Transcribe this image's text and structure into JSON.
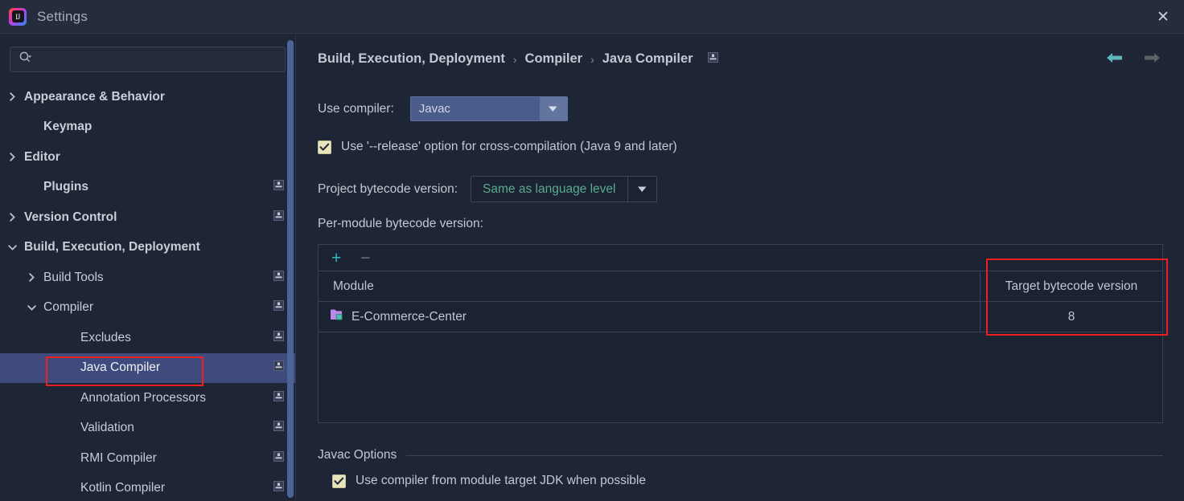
{
  "window": {
    "title": "Settings",
    "logo_text": "IJ",
    "logo_icon": "intellij-idea-logo",
    "close_icon": "close-icon"
  },
  "search": {
    "value": "",
    "placeholder": "",
    "icon": "search-icon"
  },
  "sidebar": {
    "items": [
      {
        "label": "Appearance & Behavior",
        "twisty": "chevron-right-icon",
        "indent": 22,
        "bold": true,
        "badge": false,
        "selected": false
      },
      {
        "label": "Keymap",
        "twisty": "none",
        "indent": 46,
        "bold": true,
        "badge": false,
        "selected": false
      },
      {
        "label": "Editor",
        "twisty": "chevron-right-icon",
        "indent": 22,
        "bold": true,
        "badge": false,
        "selected": false
      },
      {
        "label": "Plugins",
        "twisty": "none",
        "indent": 46,
        "bold": true,
        "badge": true,
        "selected": false
      },
      {
        "label": "Version Control",
        "twisty": "chevron-right-icon",
        "indent": 22,
        "bold": true,
        "badge": true,
        "selected": false
      },
      {
        "label": "Build, Execution, Deployment",
        "twisty": "chevron-down-icon",
        "indent": 22,
        "bold": true,
        "badge": false,
        "selected": false
      },
      {
        "label": "Build Tools",
        "twisty": "chevron-right-icon",
        "indent": 46,
        "bold": false,
        "badge": true,
        "selected": false
      },
      {
        "label": "Compiler",
        "twisty": "chevron-down-icon",
        "indent": 46,
        "bold": false,
        "badge": true,
        "selected": false
      },
      {
        "label": "Excludes",
        "twisty": "none",
        "indent": 92,
        "bold": false,
        "badge": true,
        "selected": false
      },
      {
        "label": "Java Compiler",
        "twisty": "none",
        "indent": 92,
        "bold": false,
        "badge": true,
        "selected": true
      },
      {
        "label": "Annotation Processors",
        "twisty": "none",
        "indent": 92,
        "bold": false,
        "badge": true,
        "selected": false
      },
      {
        "label": "Validation",
        "twisty": "none",
        "indent": 92,
        "bold": false,
        "badge": true,
        "selected": false
      },
      {
        "label": "RMI Compiler",
        "twisty": "none",
        "indent": 92,
        "bold": false,
        "badge": true,
        "selected": false
      },
      {
        "label": "Kotlin Compiler",
        "twisty": "none",
        "indent": 92,
        "bold": false,
        "badge": true,
        "selected": false
      }
    ],
    "scrollbar": "vertical-scrollbar"
  },
  "breadcrumb": {
    "crumbs": [
      "Build, Execution, Deployment",
      "Compiler",
      "Java Compiler"
    ],
    "separator": "›",
    "badge_icon": "project-scope-badge-icon"
  },
  "nav": {
    "back_icon": "arrow-left-icon",
    "forward_icon": "arrow-right-icon"
  },
  "main": {
    "use_compiler_label": "Use compiler:",
    "use_compiler_value": "Javac",
    "release_option_label": "Use '--release' option for cross-compilation (Java 9 and later)",
    "release_option_checked": true,
    "project_bytecode_label": "Project bytecode version:",
    "project_bytecode_value": "Same as language level",
    "per_module_label": "Per-module bytecode version:"
  },
  "table": {
    "add_label": "+",
    "remove_label": "−",
    "add_icon": "plus-icon",
    "remove_icon": "minus-icon",
    "columns": [
      "Module",
      "Target bytecode version"
    ],
    "rows": [
      {
        "module": "E-Commerce-Center",
        "module_icon": "module-folder-icon",
        "target": "8"
      }
    ]
  },
  "javac_options": {
    "section_title": "Javac Options",
    "use_module_jdk_label": "Use compiler from module target JDK when possible",
    "use_module_jdk_checked": true
  },
  "annotations": {
    "highlight_color": "#ef1f1f",
    "boxes": [
      "sidebar-java-compiler",
      "target-bytecode-column"
    ]
  },
  "colors": {
    "background": "#1e2535",
    "titlebar": "#252c3e",
    "selection": "#3f4a7d",
    "accent_teal": "#30b3c4",
    "green_text": "#5aab8e",
    "checkbox_fill": "#e8e4bb"
  }
}
